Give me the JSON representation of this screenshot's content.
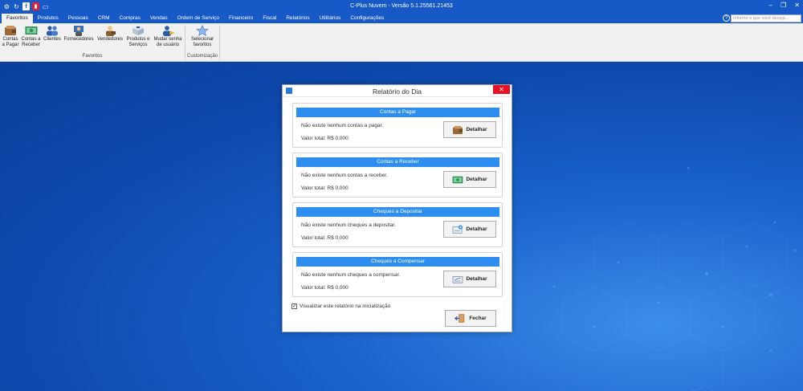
{
  "window": {
    "title": "C-Plus Nuvem - Versão 5.1.25561.21453"
  },
  "quick_access": [
    "gear-icon",
    "refresh-icon",
    "facebook-icon",
    "report-icon",
    "chat-icon"
  ],
  "quick_access_labels": {
    "facebook": "f"
  },
  "menu": {
    "tabs": [
      "Favoritos",
      "Produtos",
      "Pessoas",
      "CRM",
      "Compras",
      "Vendas",
      "Ordem de Serviço",
      "Financeiro",
      "Fiscal",
      "Relatórios",
      "Utilitários",
      "Configurações"
    ],
    "active": "Favoritos",
    "search_placeholder": "Informe o que você deseja..."
  },
  "ribbon": {
    "buttons": [
      {
        "label": "Contas a Pagar",
        "icon": "wallet-icon"
      },
      {
        "label": "Contas a Receber",
        "icon": "money-icon"
      },
      {
        "label": "Clientes",
        "icon": "users-icon"
      },
      {
        "label": "Fornecedores",
        "icon": "supplier-icon"
      },
      {
        "label": "Vendedores",
        "icon": "seller-icon"
      },
      {
        "label": "Produtos e Serviços",
        "icon": "box-icon"
      },
      {
        "label": "Mudar senha de usuário",
        "icon": "user-key-icon"
      },
      {
        "label": "Selecionar favoritos",
        "icon": "star-icon"
      }
    ],
    "groups": [
      "Favoritos",
      "Customização"
    ]
  },
  "dialog": {
    "title": "Relatório do Dia",
    "panels": [
      {
        "header": "Contas a Pagar",
        "message": "Não existe nenhum contas a pagar.",
        "total": "Valor total: R$ 0,000",
        "button": "Detalhar",
        "icon": "wallet-icon"
      },
      {
        "header": "Contas a Receber",
        "message": "Não existe nenhum contas a receber.",
        "total": "Valor total: R$ 0,000",
        "button": "Detalhar",
        "icon": "money-icon"
      },
      {
        "header": "Cheques a Depositar",
        "message": "Não existe nenhum cheques a depositar.",
        "total": "Valor total: R$ 0,000",
        "button": "Detalhar",
        "icon": "cheque-deposit-icon"
      },
      {
        "header": "Cheques a Compensar",
        "message": "Não existe nenhum cheques a compensar.",
        "total": "Valor total: R$ 0,000",
        "button": "Detalhar",
        "icon": "cheque-icon"
      }
    ],
    "checkbox_label": "Visualizar este relatório na inicialização",
    "checkbox_checked": true,
    "close_label": "Fechar"
  },
  "colors": {
    "titlebar": "#1659c7",
    "panel_header": "#2d8ef0",
    "close": "#e81123"
  }
}
